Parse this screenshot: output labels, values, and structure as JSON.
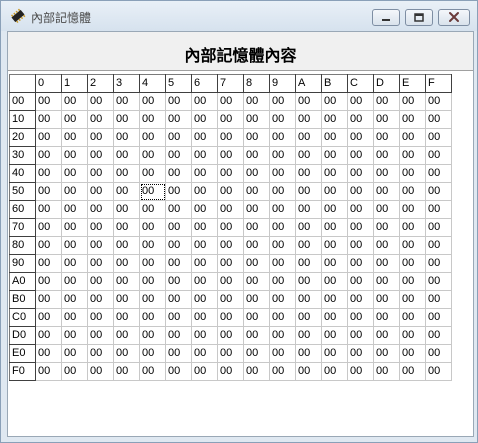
{
  "window": {
    "title": "內部記憶體"
  },
  "header": {
    "title": "內部記憶體內容"
  },
  "grid": {
    "column_headers": [
      "0",
      "1",
      "2",
      "3",
      "4",
      "5",
      "6",
      "7",
      "8",
      "9",
      "A",
      "B",
      "C",
      "D",
      "E",
      "F"
    ],
    "row_headers": [
      "00",
      "10",
      "20",
      "30",
      "40",
      "50",
      "60",
      "70",
      "80",
      "90",
      "A0",
      "B0",
      "C0",
      "D0",
      "E0",
      "F0"
    ],
    "cells": [
      [
        "00",
        "00",
        "00",
        "00",
        "00",
        "00",
        "00",
        "00",
        "00",
        "00",
        "00",
        "00",
        "00",
        "00",
        "00",
        "00"
      ],
      [
        "00",
        "00",
        "00",
        "00",
        "00",
        "00",
        "00",
        "00",
        "00",
        "00",
        "00",
        "00",
        "00",
        "00",
        "00",
        "00"
      ],
      [
        "00",
        "00",
        "00",
        "00",
        "00",
        "00",
        "00",
        "00",
        "00",
        "00",
        "00",
        "00",
        "00",
        "00",
        "00",
        "00"
      ],
      [
        "00",
        "00",
        "00",
        "00",
        "00",
        "00",
        "00",
        "00",
        "00",
        "00",
        "00",
        "00",
        "00",
        "00",
        "00",
        "00"
      ],
      [
        "00",
        "00",
        "00",
        "00",
        "00",
        "00",
        "00",
        "00",
        "00",
        "00",
        "00",
        "00",
        "00",
        "00",
        "00",
        "00"
      ],
      [
        "00",
        "00",
        "00",
        "00",
        "00",
        "00",
        "00",
        "00",
        "00",
        "00",
        "00",
        "00",
        "00",
        "00",
        "00",
        "00"
      ],
      [
        "00",
        "00",
        "00",
        "00",
        "00",
        "00",
        "00",
        "00",
        "00",
        "00",
        "00",
        "00",
        "00",
        "00",
        "00",
        "00"
      ],
      [
        "00",
        "00",
        "00",
        "00",
        "00",
        "00",
        "00",
        "00",
        "00",
        "00",
        "00",
        "00",
        "00",
        "00",
        "00",
        "00"
      ],
      [
        "00",
        "00",
        "00",
        "00",
        "00",
        "00",
        "00",
        "00",
        "00",
        "00",
        "00",
        "00",
        "00",
        "00",
        "00",
        "00"
      ],
      [
        "00",
        "00",
        "00",
        "00",
        "00",
        "00",
        "00",
        "00",
        "00",
        "00",
        "00",
        "00",
        "00",
        "00",
        "00",
        "00"
      ],
      [
        "00",
        "00",
        "00",
        "00",
        "00",
        "00",
        "00",
        "00",
        "00",
        "00",
        "00",
        "00",
        "00",
        "00",
        "00",
        "00"
      ],
      [
        "00",
        "00",
        "00",
        "00",
        "00",
        "00",
        "00",
        "00",
        "00",
        "00",
        "00",
        "00",
        "00",
        "00",
        "00",
        "00"
      ],
      [
        "00",
        "00",
        "00",
        "00",
        "00",
        "00",
        "00",
        "00",
        "00",
        "00",
        "00",
        "00",
        "00",
        "00",
        "00",
        "00"
      ],
      [
        "00",
        "00",
        "00",
        "00",
        "00",
        "00",
        "00",
        "00",
        "00",
        "00",
        "00",
        "00",
        "00",
        "00",
        "00",
        "00"
      ],
      [
        "00",
        "00",
        "00",
        "00",
        "00",
        "00",
        "00",
        "00",
        "00",
        "00",
        "00",
        "00",
        "00",
        "00",
        "00",
        "00"
      ],
      [
        "00",
        "00",
        "00",
        "00",
        "00",
        "00",
        "00",
        "00",
        "00",
        "00",
        "00",
        "00",
        "00",
        "00",
        "00",
        "00"
      ]
    ],
    "selected_cell": {
      "row": 5,
      "col": 4
    }
  },
  "icons": {
    "app": "chip-icon",
    "minimize": "minimize-icon",
    "maximize": "maximize-icon",
    "close": "close-icon"
  },
  "colors": {
    "titlebar": "#dfe8f1",
    "grid_line": "#c8c8c8",
    "header_border": "#404040",
    "close_x": "#a03030"
  }
}
